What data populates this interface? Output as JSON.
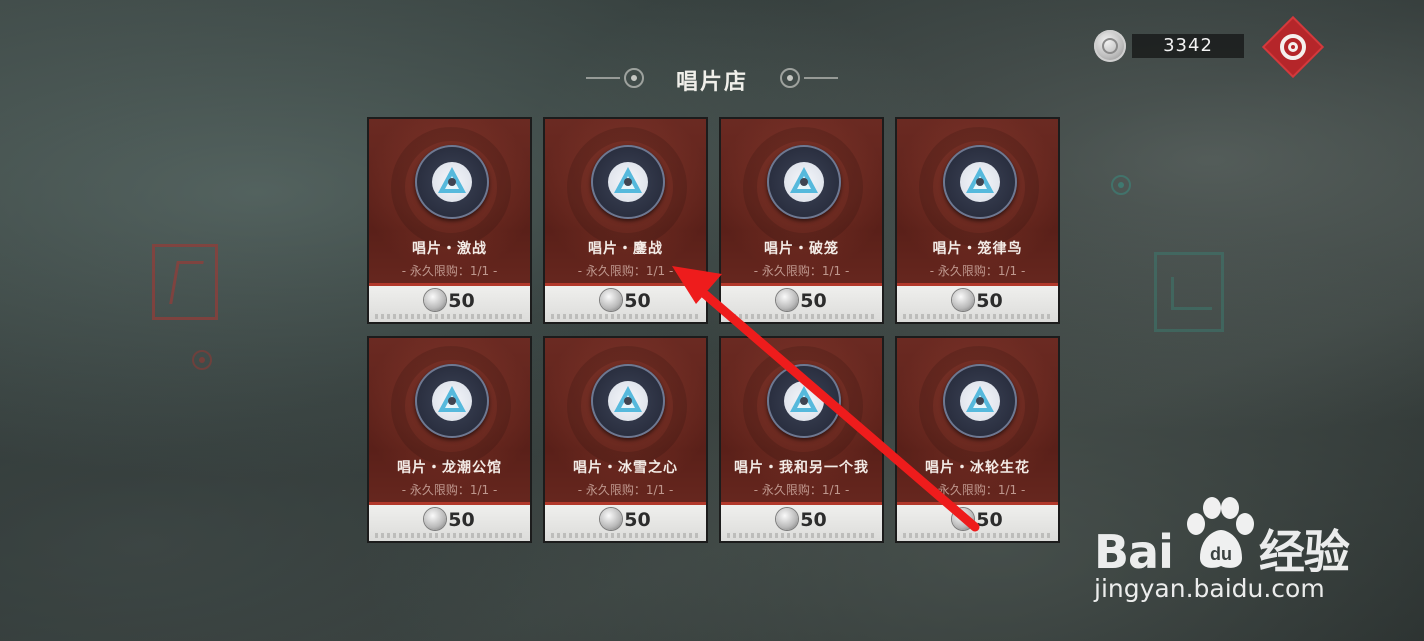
{
  "shop": {
    "title": "唱片店",
    "currency_amount": "3342",
    "menu_icon": "diamond-target-icon"
  },
  "items": [
    {
      "name": "唱片・激战",
      "limit": "- 永久限购：1/1 -",
      "price": "50"
    },
    {
      "name": "唱片・鏖战",
      "limit": "- 永久限购：1/1 -",
      "price": "50"
    },
    {
      "name": "唱片・破笼",
      "limit": "- 永久限购：1/1 -",
      "price": "50"
    },
    {
      "name": "唱片・笼律鸟",
      "limit": "- 永久限购：1/1 -",
      "price": "50"
    },
    {
      "name": "唱片・龙潮公馆",
      "limit": "- 永久限购：1/1 -",
      "price": "50"
    },
    {
      "name": "唱片・冰雪之心",
      "limit": "- 永久限购：1/1 -",
      "price": "50"
    },
    {
      "name": "唱片・我和另一个我",
      "limit": "- 永久限购：1/1 -",
      "price": "50"
    },
    {
      "name": "唱片・冰轮生花",
      "limit": "- 永久限购：1/1 -",
      "price": "50"
    }
  ],
  "watermark": {
    "brand": "Bai",
    "brand_suffix": "经验",
    "url": "jingyan.baidu.com"
  },
  "colors": {
    "card_bg": "#5a2019",
    "accent_red": "#b5262a",
    "annotation_arrow": "#ee1c1c"
  }
}
